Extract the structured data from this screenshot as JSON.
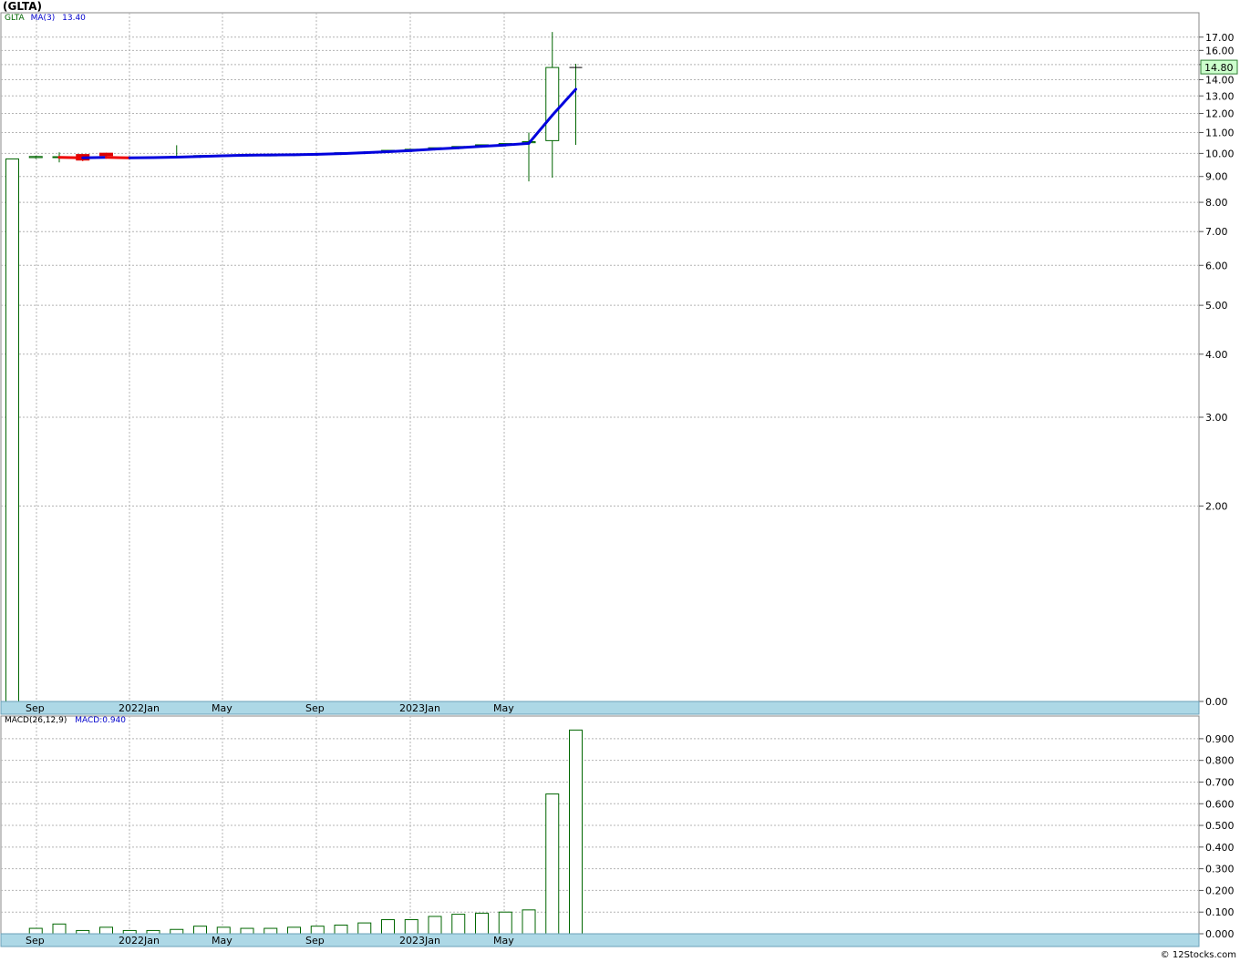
{
  "header": {
    "symbol": "(GLTA)"
  },
  "price_legend": {
    "symbol": "GLTA",
    "ma_label": "MA(3)",
    "ma_value": "13.40"
  },
  "macd_legend": {
    "name": "MACD(26,12,9)",
    "value_label": "MACD:0.940"
  },
  "last_price_badge": "14.80",
  "footer": {
    "credit": "© 12Stocks.com"
  },
  "colors": {
    "up": "#006600",
    "down": "#dd0000",
    "ma_up": "#0000dd",
    "ma_down": "#ee0000",
    "axis_band": "#add8e6",
    "grid": "#b4b4b4",
    "badge_bg": "#ccffcc"
  },
  "chart_data": [
    {
      "type": "candlestick",
      "title": "(GLTA)",
      "y_scale": "log",
      "x_tick_labels": [
        "Sep",
        "2022Jan",
        "May",
        "Sep",
        "2023Jan",
        "May"
      ],
      "y_tick_labels": [
        "17.00",
        "16.00",
        "15.00",
        "14.00",
        "13.00",
        "12.00",
        "11.00",
        "10.00",
        "9.00",
        "8.00",
        "7.00",
        "6.00",
        "5.00",
        "4.00",
        "3.00",
        "2.00",
        "0.00"
      ],
      "grid": true,
      "series": [
        {
          "name": "GLTA",
          "candles": [
            {
              "o": 0.0,
              "h": 9.75,
              "l": 0.0,
              "c": 9.75
            },
            {
              "o": 9.81,
              "h": 9.89,
              "l": 9.76,
              "c": 9.86
            },
            {
              "o": 9.84,
              "h": 10.05,
              "l": 9.6,
              "c": 9.85
            },
            {
              "o": 9.95,
              "h": 9.97,
              "l": 9.65,
              "c": 9.7
            },
            {
              "o": 10.01,
              "h": 10.03,
              "l": 9.88,
              "c": 9.9
            },
            {
              "o": 9.82,
              "h": 9.84,
              "l": 9.78,
              "c": 9.8
            },
            {
              "o": 9.84,
              "h": 9.86,
              "l": 9.81,
              "c": 9.83
            },
            {
              "o": 9.82,
              "h": 10.38,
              "l": 9.8,
              "c": 9.86
            },
            {
              "o": 9.88,
              "h": 9.92,
              "l": 9.86,
              "c": 9.9
            },
            {
              "o": 9.91,
              "h": 9.94,
              "l": 9.89,
              "c": 9.92
            },
            {
              "o": 9.92,
              "h": 9.95,
              "l": 9.9,
              "c": 9.93
            },
            {
              "o": 9.92,
              "h": 9.94,
              "l": 9.9,
              "c": 9.93
            },
            {
              "o": 9.94,
              "h": 9.96,
              "l": 9.93,
              "c": 9.95
            },
            {
              "o": 9.98,
              "h": 10.0,
              "l": 9.97,
              "c": 9.99
            },
            {
              "o": 10.02,
              "h": 10.04,
              "l": 10.01,
              "c": 10.03
            },
            {
              "o": 10.05,
              "h": 10.07,
              "l": 10.04,
              "c": 10.06
            },
            {
              "o": 10.12,
              "h": 10.15,
              "l": 10.11,
              "c": 10.14
            },
            {
              "o": 10.17,
              "h": 10.2,
              "l": 10.16,
              "c": 10.19
            },
            {
              "o": 10.24,
              "h": 10.27,
              "l": 10.23,
              "c": 10.26
            },
            {
              "o": 10.3,
              "h": 10.33,
              "l": 10.29,
              "c": 10.32
            },
            {
              "o": 10.38,
              "h": 10.41,
              "l": 10.37,
              "c": 10.4
            },
            {
              "o": 10.44,
              "h": 10.47,
              "l": 10.43,
              "c": 10.46
            },
            {
              "o": 10.5,
              "h": 11.0,
              "l": 8.8,
              "c": 10.55
            },
            {
              "o": 10.6,
              "h": 17.4,
              "l": 8.95,
              "c": 14.8
            },
            {
              "o": 14.8,
              "h": 15.05,
              "l": 10.4,
              "c": 14.8
            }
          ]
        },
        {
          "name": "MA(3)",
          "values": [
            null,
            null,
            9.82,
            9.8,
            9.82,
            9.8,
            9.81,
            9.83,
            9.86,
            9.89,
            9.92,
            9.93,
            9.94,
            9.96,
            9.99,
            10.03,
            10.08,
            10.13,
            10.2,
            10.26,
            10.33,
            10.39,
            10.47,
            11.9,
            13.4
          ]
        }
      ]
    },
    {
      "type": "bar",
      "title": "MACD(26,12,9)",
      "x_tick_labels": [
        "Sep",
        "2022Jan",
        "May",
        "Sep",
        "2023Jan",
        "May"
      ],
      "y_tick_labels": [
        "0.900",
        "0.800",
        "0.700",
        "0.600",
        "0.500",
        "0.400",
        "0.300",
        "0.200",
        "0.100",
        "0.000"
      ],
      "ylim": [
        0,
        0.95
      ],
      "grid": true,
      "series": [
        {
          "name": "MACD",
          "values": [
            0.0,
            0.025,
            0.045,
            0.015,
            0.03,
            0.015,
            0.015,
            0.02,
            0.035,
            0.03,
            0.025,
            0.025,
            0.03,
            0.035,
            0.04,
            0.05,
            0.065,
            0.065,
            0.08,
            0.09,
            0.095,
            0.1,
            0.11,
            0.645,
            0.94
          ]
        }
      ]
    }
  ]
}
